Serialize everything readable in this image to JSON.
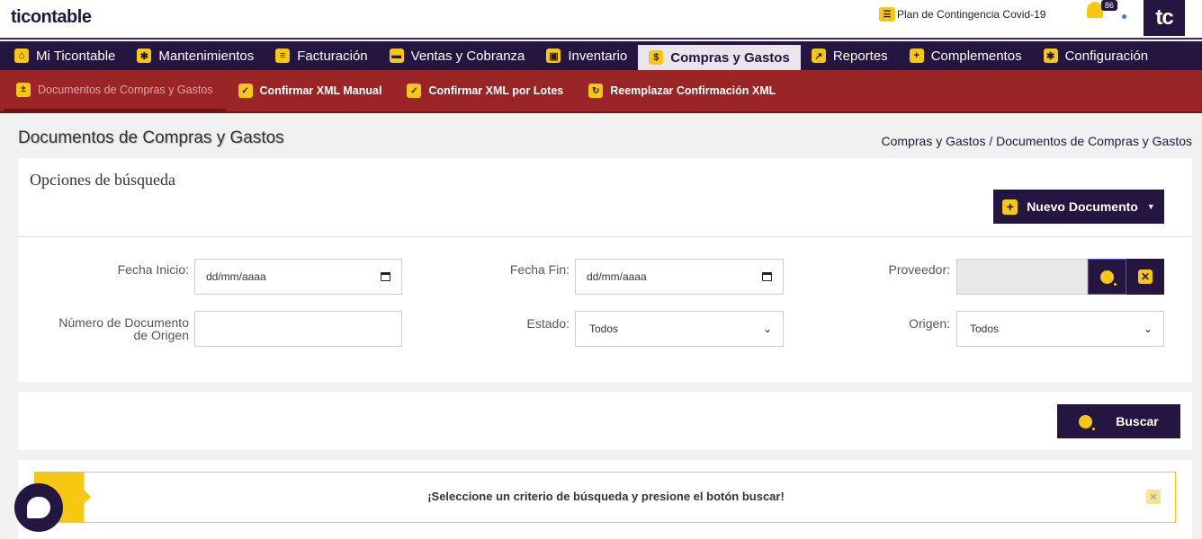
{
  "header": {
    "logo": "ticontable",
    "contingency": "Plan de Contingencia Covid-19",
    "notifications_count": "86",
    "badge": "tc"
  },
  "mainnav": [
    {
      "label": "Mi Ticontable",
      "icon": "home-icon"
    },
    {
      "label": "Mantenimientos",
      "icon": "gear-icon"
    },
    {
      "label": "Facturación",
      "icon": "invoice-icon"
    },
    {
      "label": "Ventas y Cobranza",
      "icon": "truck-icon"
    },
    {
      "label": "Inventario",
      "icon": "boxes-icon"
    },
    {
      "label": "Compras y Gastos",
      "icon": "money-bag-icon",
      "active": true
    },
    {
      "label": "Reportes",
      "icon": "chart-icon"
    },
    {
      "label": "Complementos",
      "icon": "plus-icon"
    },
    {
      "label": "Configuración",
      "icon": "gear-icon"
    }
  ],
  "subnav": [
    {
      "label": "Documentos de Compras y Gastos",
      "active": true
    },
    {
      "label": "Confirmar XML Manual"
    },
    {
      "label": "Confirmar XML por Lotes"
    },
    {
      "label": "Reemplazar Confirmación XML"
    }
  ],
  "page": {
    "title": "Documentos de Compras y Gastos",
    "breadcrumb": "Compras y Gastos / Documentos de Compras y Gastos"
  },
  "search": {
    "title": "Opciones de búsqueda",
    "new_button": "Nuevo Documento",
    "fecha_inicio_label": "Fecha Inicio:",
    "fecha_inicio_value": "dd/mm/aaaa",
    "fecha_fin_label": "Fecha Fin:",
    "fecha_fin_value": "dd/mm/aaaa",
    "proveedor_label": "Proveedor:",
    "numero_label": "Número de Documento de Origen",
    "estado_label": "Estado:",
    "estado_value": "Todos",
    "origen_label": "Origen:",
    "origen_value": "Todos",
    "buscar_button": "Buscar"
  },
  "alert": {
    "message": "¡Seleccione un criterio de búsqueda y presione el botón buscar!"
  },
  "colors": {
    "brand_dark": "#241541",
    "brand_yellow": "#f6c812",
    "subnav_red": "#9b2427"
  }
}
